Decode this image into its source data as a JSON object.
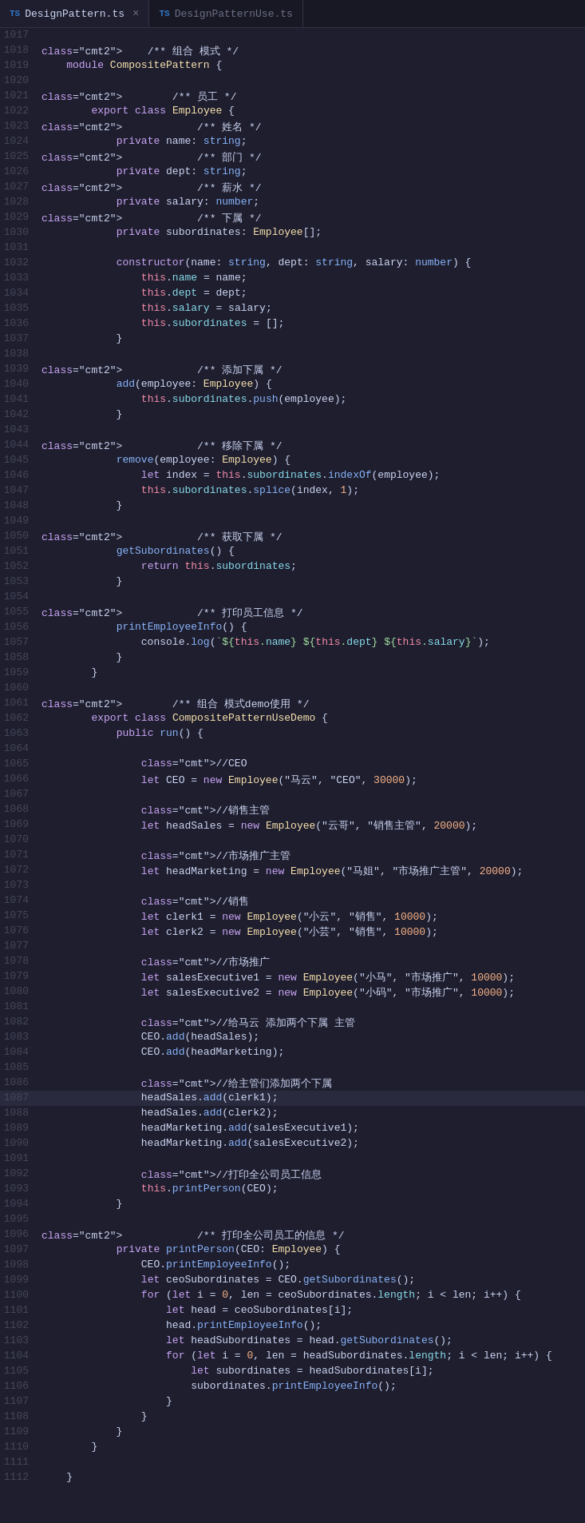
{
  "tabs": [
    {
      "label": "DesignPattern.ts",
      "active": true,
      "icon": "ts-icon"
    },
    {
      "label": "DesignPatternUse.ts",
      "active": false,
      "icon": "ts-icon"
    }
  ],
  "lines": [
    {
      "num": 1017,
      "content": "",
      "tokens": []
    },
    {
      "num": 1018,
      "content": "    /** 组合 模式 */"
    },
    {
      "num": 1019,
      "content": "    module CompositePattern {"
    },
    {
      "num": 1020,
      "content": ""
    },
    {
      "num": 1021,
      "content": "        /** 员工 */"
    },
    {
      "num": 1022,
      "content": "        export class Employee {"
    },
    {
      "num": 1023,
      "content": "            /** 姓名 */"
    },
    {
      "num": 1024,
      "content": "            private name: string;"
    },
    {
      "num": 1025,
      "content": "            /** 部门 */"
    },
    {
      "num": 1026,
      "content": "            private dept: string;"
    },
    {
      "num": 1027,
      "content": "            /** 薪水 */"
    },
    {
      "num": 1028,
      "content": "            private salary: number;"
    },
    {
      "num": 1029,
      "content": "            /** 下属 */"
    },
    {
      "num": 1030,
      "content": "            private subordinates: Employee[];"
    },
    {
      "num": 1031,
      "content": ""
    },
    {
      "num": 1032,
      "content": "            constructor(name: string, dept: string, salary: number) {"
    },
    {
      "num": 1033,
      "content": "                this.name = name;"
    },
    {
      "num": 1034,
      "content": "                this.dept = dept;"
    },
    {
      "num": 1035,
      "content": "                this.salary = salary;"
    },
    {
      "num": 1036,
      "content": "                this.subordinates = [];"
    },
    {
      "num": 1037,
      "content": "            }"
    },
    {
      "num": 1038,
      "content": ""
    },
    {
      "num": 1039,
      "content": "            /** 添加下属 */"
    },
    {
      "num": 1040,
      "content": "            add(employee: Employee) {"
    },
    {
      "num": 1041,
      "content": "                this.subordinates.push(employee);"
    },
    {
      "num": 1042,
      "content": "            }"
    },
    {
      "num": 1043,
      "content": ""
    },
    {
      "num": 1044,
      "content": "            /** 移除下属 */"
    },
    {
      "num": 1045,
      "content": "            remove(employee: Employee) {"
    },
    {
      "num": 1046,
      "content": "                let index = this.subordinates.indexOf(employee);"
    },
    {
      "num": 1047,
      "content": "                this.subordinates.splice(index, 1);"
    },
    {
      "num": 1048,
      "content": "            }"
    },
    {
      "num": 1049,
      "content": ""
    },
    {
      "num": 1050,
      "content": "            /** 获取下属 */"
    },
    {
      "num": 1051,
      "content": "            getSubordinates() {"
    },
    {
      "num": 1052,
      "content": "                return this.subordinates;"
    },
    {
      "num": 1053,
      "content": "            }"
    },
    {
      "num": 1054,
      "content": ""
    },
    {
      "num": 1055,
      "content": "            /** 打印员工信息 */"
    },
    {
      "num": 1056,
      "content": "            printEmployeeInfo() {"
    },
    {
      "num": 1057,
      "content": "                console.log(`${this.name} ${this.dept} ${this.salary}`);"
    },
    {
      "num": 1058,
      "content": "            }"
    },
    {
      "num": 1059,
      "content": "        }"
    },
    {
      "num": 1060,
      "content": ""
    },
    {
      "num": 1061,
      "content": "        /** 组合 模式demo使用 */"
    },
    {
      "num": 1062,
      "content": "        export class CompositePatternUseDemo {"
    },
    {
      "num": 1063,
      "content": "            public run() {"
    },
    {
      "num": 1064,
      "content": ""
    },
    {
      "num": 1065,
      "content": "                //CEO"
    },
    {
      "num": 1066,
      "content": "                let CEO = new Employee(\"马云\", \"CEO\", 30000);"
    },
    {
      "num": 1067,
      "content": ""
    },
    {
      "num": 1068,
      "content": "                //销售主管"
    },
    {
      "num": 1069,
      "content": "                let headSales = new Employee(\"云哥\", \"销售主管\", 20000);"
    },
    {
      "num": 1070,
      "content": ""
    },
    {
      "num": 1071,
      "content": "                //市场推广主管"
    },
    {
      "num": 1072,
      "content": "                let headMarketing = new Employee(\"马姐\", \"市场推广主管\", 20000);"
    },
    {
      "num": 1073,
      "content": ""
    },
    {
      "num": 1074,
      "content": "                //销售"
    },
    {
      "num": 1075,
      "content": "                let clerk1 = new Employee(\"小云\", \"销售\", 10000);"
    },
    {
      "num": 1076,
      "content": "                let clerk2 = new Employee(\"小芸\", \"销售\", 10000);"
    },
    {
      "num": 1077,
      "content": ""
    },
    {
      "num": 1078,
      "content": "                //市场推广"
    },
    {
      "num": 1079,
      "content": "                let salesExecutive1 = new Employee(\"小马\", \"市场推广\", 10000);"
    },
    {
      "num": 1080,
      "content": "                let salesExecutive2 = new Employee(\"小码\", \"市场推广\", 10000);"
    },
    {
      "num": 1081,
      "content": ""
    },
    {
      "num": 1082,
      "content": "                //给马云 添加两个下属 主管"
    },
    {
      "num": 1083,
      "content": "                CEO.add(headSales);"
    },
    {
      "num": 1084,
      "content": "                CEO.add(headMarketing);"
    },
    {
      "num": 1085,
      "content": ""
    },
    {
      "num": 1086,
      "content": "                //给主管们添加两个下属"
    },
    {
      "num": 1087,
      "content": "                headSales.add(clerk1);",
      "highlighted": true
    },
    {
      "num": 1088,
      "content": "                headSales.add(clerk2);"
    },
    {
      "num": 1089,
      "content": "                headMarketing.add(salesExecutive1);"
    },
    {
      "num": 1090,
      "content": "                headMarketing.add(salesExecutive2);"
    },
    {
      "num": 1091,
      "content": ""
    },
    {
      "num": 1092,
      "content": "                //打印全公司员工信息"
    },
    {
      "num": 1093,
      "content": "                this.printPerson(CEO);"
    },
    {
      "num": 1094,
      "content": "            }"
    },
    {
      "num": 1095,
      "content": ""
    },
    {
      "num": 1096,
      "content": "            /** 打印全公司员工的信息 */"
    },
    {
      "num": 1097,
      "content": "            private printPerson(CEO: Employee) {"
    },
    {
      "num": 1098,
      "content": "                CEO.printEmployeeInfo();"
    },
    {
      "num": 1099,
      "content": "                let ceoSubordinates = CEO.getSubordinates();"
    },
    {
      "num": 1100,
      "content": "                for (let i = 0, len = ceoSubordinates.length; i < len; i++) {"
    },
    {
      "num": 1101,
      "content": "                    let head = ceoSubordinates[i];"
    },
    {
      "num": 1102,
      "content": "                    head.printEmployeeInfo();"
    },
    {
      "num": 1103,
      "content": "                    let headSubordinates = head.getSubordinates();"
    },
    {
      "num": 1104,
      "content": "                    for (let i = 0, len = headSubordinates.length; i < len; i++) {"
    },
    {
      "num": 1105,
      "content": "                        let subordinates = headSubordinates[i];"
    },
    {
      "num": 1106,
      "content": "                        subordinates.printEmployeeInfo();"
    },
    {
      "num": 1107,
      "content": "                    }"
    },
    {
      "num": 1108,
      "content": "                }"
    },
    {
      "num": 1109,
      "content": "            }"
    },
    {
      "num": 1110,
      "content": "        }"
    },
    {
      "num": 1111,
      "content": ""
    },
    {
      "num": 1112,
      "content": "    }"
    }
  ]
}
